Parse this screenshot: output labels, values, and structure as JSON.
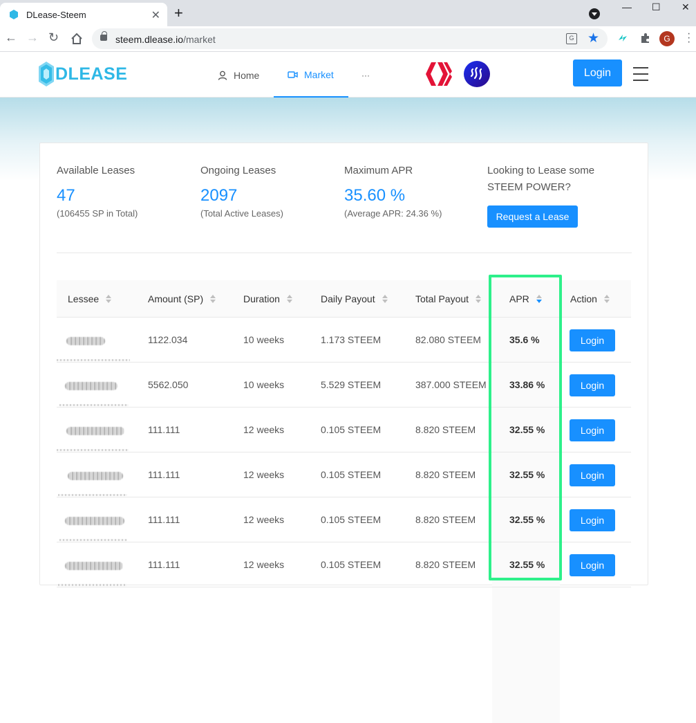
{
  "browser": {
    "tab_title": "DLease-Steem",
    "tab_close": "✕",
    "new_tab": "+",
    "url_host": "steem.dlease.io",
    "url_path": "/market",
    "profile_initial": "G",
    "window_controls": [
      "—",
      "☐",
      "✕"
    ]
  },
  "header": {
    "logo_text": "DLEASE",
    "nav": [
      {
        "label": "Home",
        "icon": "user-icon"
      },
      {
        "label": "Market",
        "icon": "video-camera-icon"
      },
      {
        "label": "···",
        "icon": "more-icon"
      }
    ],
    "login_label": "Login",
    "colors": {
      "accent": "#1890ff",
      "logo": "#2fb8e6",
      "hive": "#e31337",
      "highlight": "#2ef08a"
    }
  },
  "stats": {
    "available": {
      "label": "Available Leases",
      "value": "47",
      "sub": "(106455 SP in Total)"
    },
    "ongoing": {
      "label": "Ongoing Leases",
      "value": "2097",
      "sub": "(Total Active Leases)"
    },
    "max_apr": {
      "label": "Maximum APR",
      "value": "35.60 %",
      "sub": "(Average APR: 24.36 %)"
    },
    "cta": {
      "label": "Looking to Lease some STEEM POWER?",
      "button": "Request a Lease"
    }
  },
  "table": {
    "columns": [
      "Lessee",
      "Amount (SP)",
      "Duration",
      "Daily Payout",
      "Total Payout",
      "APR",
      "Action"
    ],
    "sorted_column": "APR",
    "sort_order": "descending",
    "rows": [
      {
        "amount": "1122.034",
        "duration": "10 weeks",
        "daily": "1.173 STEEM",
        "total": "82.080 STEEM",
        "apr": "35.6 %",
        "action": "Login"
      },
      {
        "amount": "5562.050",
        "duration": "10 weeks",
        "daily": "5.529 STEEM",
        "total": "387.000 STEEM",
        "apr": "33.86 %",
        "action": "Login"
      },
      {
        "amount": "111.111",
        "duration": "12 weeks",
        "daily": "0.105 STEEM",
        "total": "8.820 STEEM",
        "apr": "32.55 %",
        "action": "Login"
      },
      {
        "amount": "111.111",
        "duration": "12 weeks",
        "daily": "0.105 STEEM",
        "total": "8.820 STEEM",
        "apr": "32.55 %",
        "action": "Login"
      },
      {
        "amount": "111.111",
        "duration": "12 weeks",
        "daily": "0.105 STEEM",
        "total": "8.820 STEEM",
        "apr": "32.55 %",
        "action": "Login"
      },
      {
        "amount": "111.111",
        "duration": "12 weeks",
        "daily": "0.105 STEEM",
        "total": "8.820 STEEM",
        "apr": "32.55 %",
        "action": "Login"
      }
    ]
  }
}
